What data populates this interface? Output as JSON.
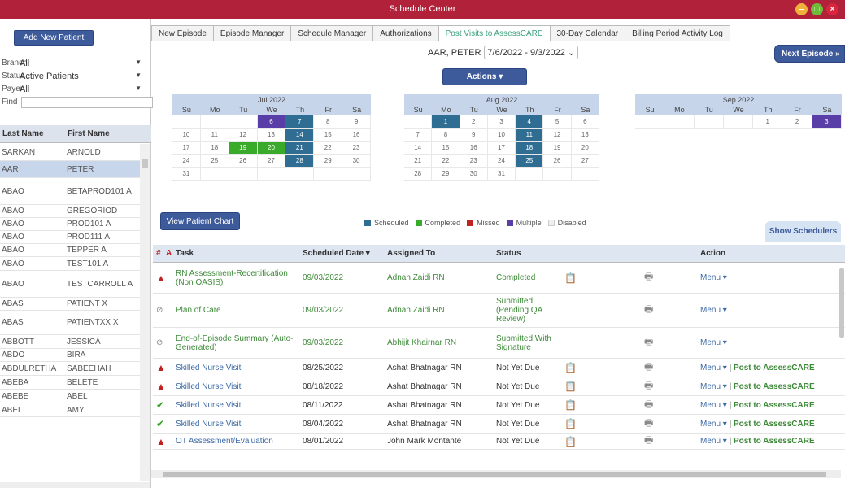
{
  "window": {
    "title": "Schedule Center"
  },
  "left": {
    "add_button": "Add New Patient",
    "filters": [
      {
        "label": "Branch",
        "value": "All"
      },
      {
        "label": "Status",
        "value": "Active Patients"
      },
      {
        "label": "Payer",
        "value": "All"
      }
    ],
    "find_label": "Find",
    "columns": [
      "Last Name",
      "First Name"
    ],
    "patients": [
      {
        "last": "SARKAN",
        "first": "ARNOLD"
      },
      {
        "last": "AAR",
        "first": "PETER"
      },
      {
        "last": "ABAO",
        "first": "BETAPROD101 A"
      },
      {
        "last": "ABAO",
        "first": "GREGORIOD"
      },
      {
        "last": "ABAO",
        "first": "PROD101 A"
      },
      {
        "last": "ABAO",
        "first": "PROD111 A"
      },
      {
        "last": "ABAO",
        "first": "TEPPER A"
      },
      {
        "last": "ABAO",
        "first": "TEST101 A"
      },
      {
        "last": "ABAO",
        "first": "TESTCARROLL A"
      },
      {
        "last": "ABAS",
        "first": "PATIENT X"
      },
      {
        "last": "ABAS",
        "first": "PATIENTXX X"
      },
      {
        "last": "ABBOTT",
        "first": "JESSICA"
      },
      {
        "last": "ABDO",
        "first": "BIRA"
      },
      {
        "last": "ABDULRETHA",
        "first": "SABEEHAH"
      },
      {
        "last": "ABEBA",
        "first": "BELETE"
      },
      {
        "last": "ABEBE",
        "first": "ABEL"
      },
      {
        "last": "ABEL",
        "first": "AMY"
      }
    ]
  },
  "tabs": [
    "New Episode",
    "Episode Manager",
    "Schedule Manager",
    "Authorizations",
    "Post Visits to AssessCARE",
    "30-Day Calendar",
    "Billing Period Activity Log"
  ],
  "next_episode": "Next Episode »",
  "patient_name": "AAR, PETER",
  "episode": "7/6/2022 - 9/3/2022",
  "actions": "Actions",
  "calendars": [
    {
      "title": "Jul 2022",
      "dows": [
        "Su",
        "Mo",
        "Tu",
        "We",
        "Th",
        "Fr",
        "Sa"
      ],
      "days": [
        "",
        "",
        "",
        "6",
        "7",
        "8",
        "9",
        "10",
        "11",
        "12",
        "13",
        "14",
        "15",
        "16",
        "17",
        "18",
        "19",
        "20",
        "21",
        "22",
        "23",
        "24",
        "25",
        "26",
        "27",
        "28",
        "29",
        "30",
        "31",
        "",
        "",
        "",
        "",
        "",
        ""
      ]
    },
    {
      "title": "Aug 2022",
      "dows": [
        "Su",
        "Mo",
        "Tu",
        "We",
        "Th",
        "Fr",
        "Sa"
      ],
      "days": [
        "",
        "1",
        "2",
        "3",
        "4",
        "5",
        "6",
        "7",
        "8",
        "9",
        "10",
        "11",
        "12",
        "13",
        "14",
        "15",
        "16",
        "17",
        "18",
        "19",
        "20",
        "21",
        "22",
        "23",
        "24",
        "25",
        "26",
        "27",
        "28",
        "29",
        "30",
        "31",
        "",
        "",
        ""
      ]
    },
    {
      "title": "Sep 2022",
      "dows": [
        "Su",
        "Mo",
        "Tu",
        "We",
        "Th",
        "Fr",
        "Sa"
      ],
      "days": [
        "",
        "",
        "",
        "",
        "1",
        "2",
        "3"
      ]
    }
  ],
  "view_chart": "View Patient Chart",
  "legend": [
    {
      "label": "Scheduled",
      "color": "#2f6d93"
    },
    {
      "label": "Completed",
      "color": "#3aaa2a"
    },
    {
      "label": "Missed",
      "color": "#c0221f"
    },
    {
      "label": "Multiple",
      "color": "#5a3ea8"
    },
    {
      "label": "Disabled",
      "color": "#eeeeee"
    }
  ],
  "show_schedulers": "Show Schedulers",
  "grid": {
    "headers": {
      "num": "#",
      "a": "A",
      "task": "Task",
      "date": "Scheduled Date ▾",
      "assigned": "Assigned To",
      "status": "Status",
      "action": "Action"
    },
    "rows": [
      {
        "task": "RN Assessment-Recertification (Non OASIS)",
        "date": "09/03/2022",
        "assigned": "Adnan Zaidi RN",
        "status": "Completed",
        "menu": "Menu ▾",
        "post": ""
      },
      {
        "task": "Plan of Care",
        "date": "09/03/2022",
        "assigned": "Adnan Zaidi RN",
        "status": "Submitted (Pending QA Review)",
        "menu": "Menu ▾",
        "post": ""
      },
      {
        "task": "End-of-Episode Summary (Auto-Generated)",
        "date": "09/03/2022",
        "assigned": "Abhijit Khairnar RN",
        "status": "Submitted With Signature",
        "menu": "Menu ▾",
        "post": ""
      },
      {
        "task": "Skilled Nurse Visit",
        "date": "08/25/2022",
        "assigned": "Ashat Bhatnagar RN",
        "status": "Not Yet Due",
        "menu": "Menu ▾",
        "post": "Post to AssessCARE"
      },
      {
        "task": "Skilled Nurse Visit",
        "date": "08/18/2022",
        "assigned": "Ashat Bhatnagar RN",
        "status": "Not Yet Due",
        "menu": "Menu ▾",
        "post": "Post to AssessCARE"
      },
      {
        "task": "Skilled Nurse Visit",
        "date": "08/11/2022",
        "assigned": "Ashat Bhatnagar RN",
        "status": "Not Yet Due",
        "menu": "Menu ▾",
        "post": "Post to AssessCARE"
      },
      {
        "task": "Skilled Nurse Visit",
        "date": "08/04/2022",
        "assigned": "Ashat Bhatnagar RN",
        "status": "Not Yet Due",
        "menu": "Menu ▾",
        "post": "Post to AssessCARE"
      },
      {
        "task": "OT Assessment/Evaluation",
        "date": "08/01/2022",
        "assigned": "John Mark Montante",
        "status": "Not Yet Due",
        "menu": "Menu ▾",
        "post": "Post to AssessCARE"
      }
    ]
  }
}
